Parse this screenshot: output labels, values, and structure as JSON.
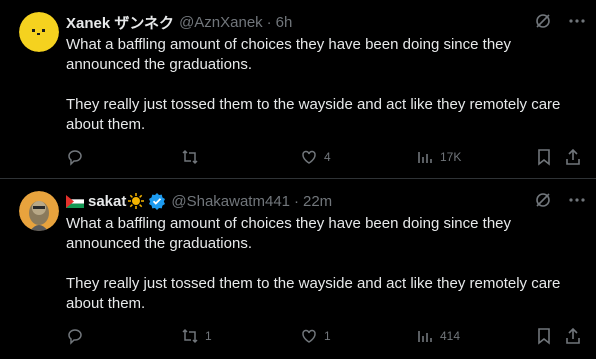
{
  "tweets": [
    {
      "name": "Xanek ザンネク",
      "handle": "@AznXanek",
      "separator": "·",
      "time": "6h",
      "paragraphs": [
        "What a baffling amount of choices they have been doing since they announced the graduations.",
        "They really just tossed them to the wayside and act like they remotely care about them."
      ],
      "actions": {
        "replies": "",
        "retweets": "",
        "likes": "4",
        "views": "17K"
      }
    },
    {
      "name": "sakat",
      "handle": "@Shakawatm441",
      "separator": "·",
      "time": "22m",
      "paragraphs": [
        "What a baffling amount of choices they have been doing since they announced the graduations.",
        "They really just tossed them to the wayside and act like they remotely care about them."
      ],
      "actions": {
        "replies": "",
        "retweets": "1",
        "likes": "1",
        "views": "414"
      }
    }
  ],
  "colors": {
    "background": "#000000",
    "text": "#e7e9ea",
    "muted": "#71767b",
    "verified": "#1d9bf0",
    "divider": "#2f3336"
  }
}
